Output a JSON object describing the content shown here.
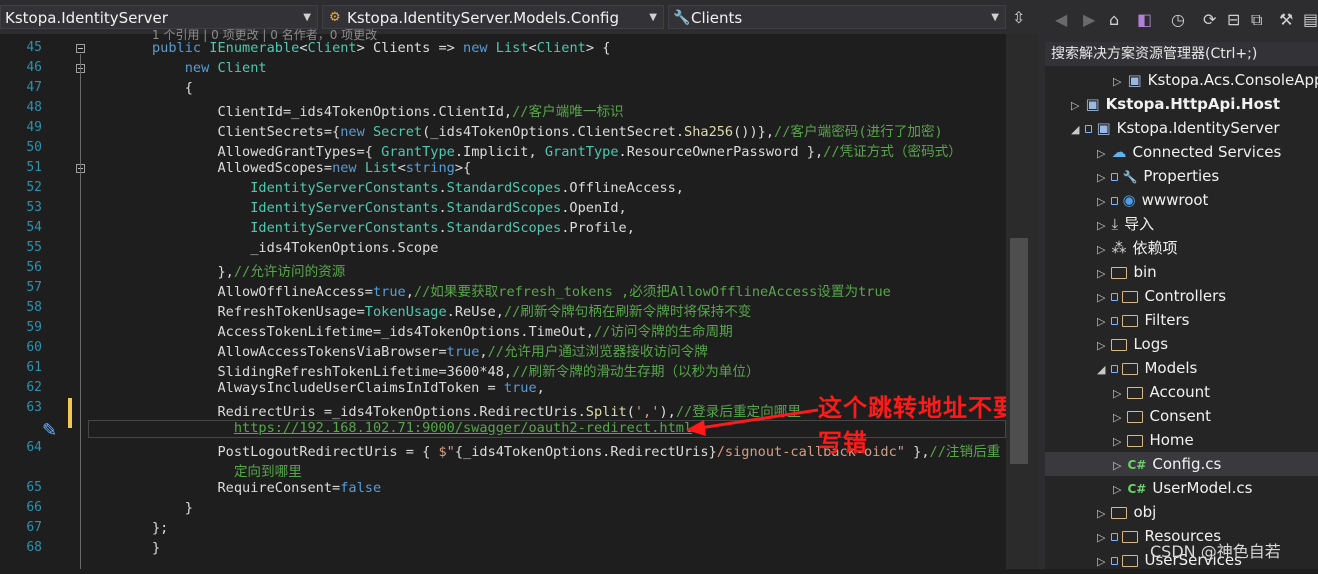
{
  "navbar": {
    "project": "Kstopa.IdentityServer",
    "type": "Kstopa.IdentityServer.Models.Config",
    "member": "Clients"
  },
  "codelens": "1 个引用 | 0 项更改 | 0 名作者，0 项更改",
  "lines": [
    {
      "n": "45",
      "html": "<span class=\"kw\">public</span> <span class=\"ty\">IEnumerable</span>&lt;<span class=\"ty\">Client</span>&gt; Clients =&gt; <span class=\"kw\">new</span> <span class=\"ty\">List</span>&lt;<span class=\"ty\">Client</span>&gt; {"
    },
    {
      "n": "46",
      "html": "    <span class=\"kw\">new</span> <span class=\"ty\">Client</span>"
    },
    {
      "n": "47",
      "html": "    {"
    },
    {
      "n": "48",
      "html": "        ClientId=_ids4TokenOptions.ClientId,<span class=\"cm\">//客户端唯一标识</span>"
    },
    {
      "n": "49",
      "html": "        ClientSecrets={<span class=\"kw\">new</span> <span class=\"ty\">Secret</span>(_ids4TokenOptions.ClientSecret.<span class=\"mt\">Sha256</span>())},<span class=\"cm\">//客户端密码(进行了加密)</span>"
    },
    {
      "n": "50",
      "html": "        AllowedGrantTypes={ <span class=\"ty\">GrantType</span>.Implicit, <span class=\"ty\">GrantType</span>.ResourceOwnerPassword },<span class=\"cm\">//凭证方式（密码式）</span>"
    },
    {
      "n": "51",
      "html": "        AllowedScopes=<span class=\"kw\">new</span> <span class=\"ty\">List</span>&lt;<span class=\"kw\">string</span>&gt;{"
    },
    {
      "n": "52",
      "html": "            <span class=\"ty\">IdentityServerConstants</span>.<span class=\"ty\">StandardScopes</span>.OfflineAccess,"
    },
    {
      "n": "53",
      "html": "            <span class=\"ty\">IdentityServerConstants</span>.<span class=\"ty\">StandardScopes</span>.OpenId,"
    },
    {
      "n": "54",
      "html": "            <span class=\"ty\">IdentityServerConstants</span>.<span class=\"ty\">StandardScopes</span>.Profile,"
    },
    {
      "n": "55",
      "html": "            _ids4TokenOptions.Scope"
    },
    {
      "n": "56",
      "html": "        },<span class=\"cm\">//允许访问的资源</span>"
    },
    {
      "n": "57",
      "html": "        AllowOfflineAccess=<span class=\"kw\">true</span>,<span class=\"cm\">//如果要获取refresh_tokens ,必须把AllowOfflineAccess设置为true</span>"
    },
    {
      "n": "58",
      "html": "        RefreshTokenUsage=<span class=\"ty\">TokenUsage</span>.ReUse,<span class=\"cm\">//刷新令牌句柄在刷新令牌时将保持不变</span>"
    },
    {
      "n": "59",
      "html": "        AccessTokenLifetime=_ids4TokenOptions.TimeOut,<span class=\"cm\">//访问令牌的生命周期</span>"
    },
    {
      "n": "60",
      "html": "        AllowAccessTokensViaBrowser=<span class=\"kw\">true</span>,<span class=\"cm\">//允许用户通过浏览器接收访问令牌</span>"
    },
    {
      "n": "61",
      "html": "        SlidingRefreshTokenLifetime=3600*48,<span class=\"cm\">//刷新令牌的滑动生存期（以秒为单位）</span>"
    },
    {
      "n": "62",
      "html": "        AlwaysIncludeUserClaimsInIdToken = <span class=\"kw\">true</span>,"
    },
    {
      "n": "63",
      "html": "        RedirectUris =_ids4TokenOptions.RedirectUris.<span class=\"mt\">Split</span>(<span class=\"st\">','</span>),<span class=\"cm\">//登录后重定向哪里</span>"
    },
    {
      "n": "",
      "html": "          <span class=\"cm\" style=\"text-decoration:underline\">https://192.168.102.71:9000/swagger/oauth2-redirect.html</span>"
    },
    {
      "n": "64",
      "html": "        PostLogoutRedirectUris = { <span class=\"st\">$\"</span>{_ids4TokenOptions.RedirectUris}<span class=\"st\">/signout-callback-oidc\"</span> },<span class=\"cm\">//注销后重</span>"
    },
    {
      "n": "",
      "html": "          <span class=\"cm\">定向到哪里</span>"
    },
    {
      "n": "65",
      "html": "        RequireConsent=<span class=\"kw\">false</span>"
    },
    {
      "n": "66",
      "html": "    }"
    },
    {
      "n": "67",
      "html": "};"
    },
    {
      "n": "68",
      "html": "}"
    }
  ],
  "annotation": "这个跳转地址不要写错",
  "solution": {
    "search": "搜索解决方案资源管理器(Ctrl+;)",
    "items": [
      {
        "label": "Kstopa.Acs.ConsoleApp",
        "bold": false
      },
      {
        "label": "Kstopa.HttpApi.Host",
        "bold": true
      },
      {
        "label": "Kstopa.IdentityServer",
        "bold": false
      },
      {
        "label": "Connected Services",
        "bold": false
      },
      {
        "label": "Properties",
        "bold": false
      },
      {
        "label": "wwwroot",
        "bold": false
      },
      {
        "label": "导入",
        "bold": false
      },
      {
        "label": "依赖项",
        "bold": false
      },
      {
        "label": "bin",
        "bold": false
      },
      {
        "label": "Controllers",
        "bold": false
      },
      {
        "label": "Filters",
        "bold": false
      },
      {
        "label": "Logs",
        "bold": false
      },
      {
        "label": "Models",
        "bold": false
      },
      {
        "label": "Account",
        "bold": false
      },
      {
        "label": "Consent",
        "bold": false
      },
      {
        "label": "Home",
        "bold": false
      },
      {
        "label": "Config.cs",
        "bold": false
      },
      {
        "label": "UserModel.cs",
        "bold": false
      },
      {
        "label": "obj",
        "bold": false
      },
      {
        "label": "Resources",
        "bold": false
      },
      {
        "label": "UserServices",
        "bold": false
      }
    ]
  },
  "watermark": "CSDN @神色自若",
  "colors": {
    "keyword": "#569cd6",
    "type": "#4ec9b0",
    "comment": "#57a64a",
    "annotation": "#ff1a1a"
  }
}
